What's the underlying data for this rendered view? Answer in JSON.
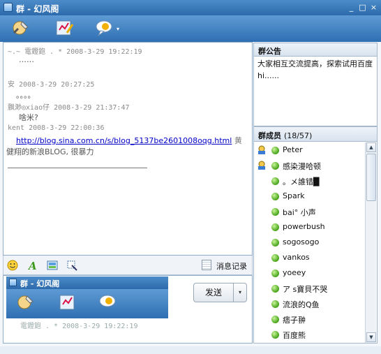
{
  "window": {
    "title": "群 - 幻风阁",
    "controls": {
      "minimize": "_",
      "maximize": "□",
      "close": "×"
    }
  },
  "toolbar": {
    "icons": [
      "tools-icon",
      "whiteboard-icon",
      "chat-bubble-icon"
    ],
    "dropdown_caret": "▾"
  },
  "chat": {
    "messages": [
      {
        "header": "~.~ 電鐙鉋 .  * 2008-3-29 19:22:19",
        "body": "……"
      },
      {
        "header": "安 2008-3-29 20:27:25",
        "body": "。。。。"
      },
      {
        "header": "飘渺◎xiao仔 2008-3-29 21:37:47",
        "body": "啥米?"
      },
      {
        "header": "kent 2008-3-29 22:00:36",
        "link": "http://blog.sina.com.cn/s/blog_5137be2601008oqg.html",
        "body_suffix": "黄",
        "body_line2": "健翔的新浪BLOG, 很暴力"
      }
    ]
  },
  "input_toolbar": {
    "icons": [
      "emoji-icon",
      "font-icon",
      "image-icon",
      "screenshot-icon"
    ],
    "history_label": "消息记录"
  },
  "input": {
    "thumb_title": "群 - 幻风阁",
    "thumb_faded_text": "電鐙鉋 .  * 2008-3-29 19:22:19",
    "send_label": "发送",
    "send_dropdown": "▾"
  },
  "announcement": {
    "header": "群公告",
    "text": "大家相互交流提高，探索试用百度hi......"
  },
  "members": {
    "header": "群成员",
    "count": "(18/57)",
    "list": [
      {
        "name": "Peter",
        "admin": true
      },
      {
        "name": "感染漫哈顿",
        "admin": true
      },
      {
        "name": "。メ誰错█",
        "admin": false
      },
      {
        "name": "Spark",
        "admin": false
      },
      {
        "name": "bai° 小声",
        "admin": false
      },
      {
        "name": "powerbush",
        "admin": false
      },
      {
        "name": "sogosogo",
        "admin": false
      },
      {
        "name": "vankos",
        "admin": false
      },
      {
        "name": "yoeey",
        "admin": false
      },
      {
        "name": "ア s寶貝不哭",
        "admin": false
      },
      {
        "name": "流浪的Q鱼",
        "admin": false
      },
      {
        "name": "痞子翀",
        "admin": false
      },
      {
        "name": "百度熊",
        "admin": false
      }
    ]
  },
  "colors": {
    "titlebar": "#2c6aac",
    "toolbar": "#4a8acb",
    "link": "#0000c8",
    "online_dot": "#45a318"
  }
}
